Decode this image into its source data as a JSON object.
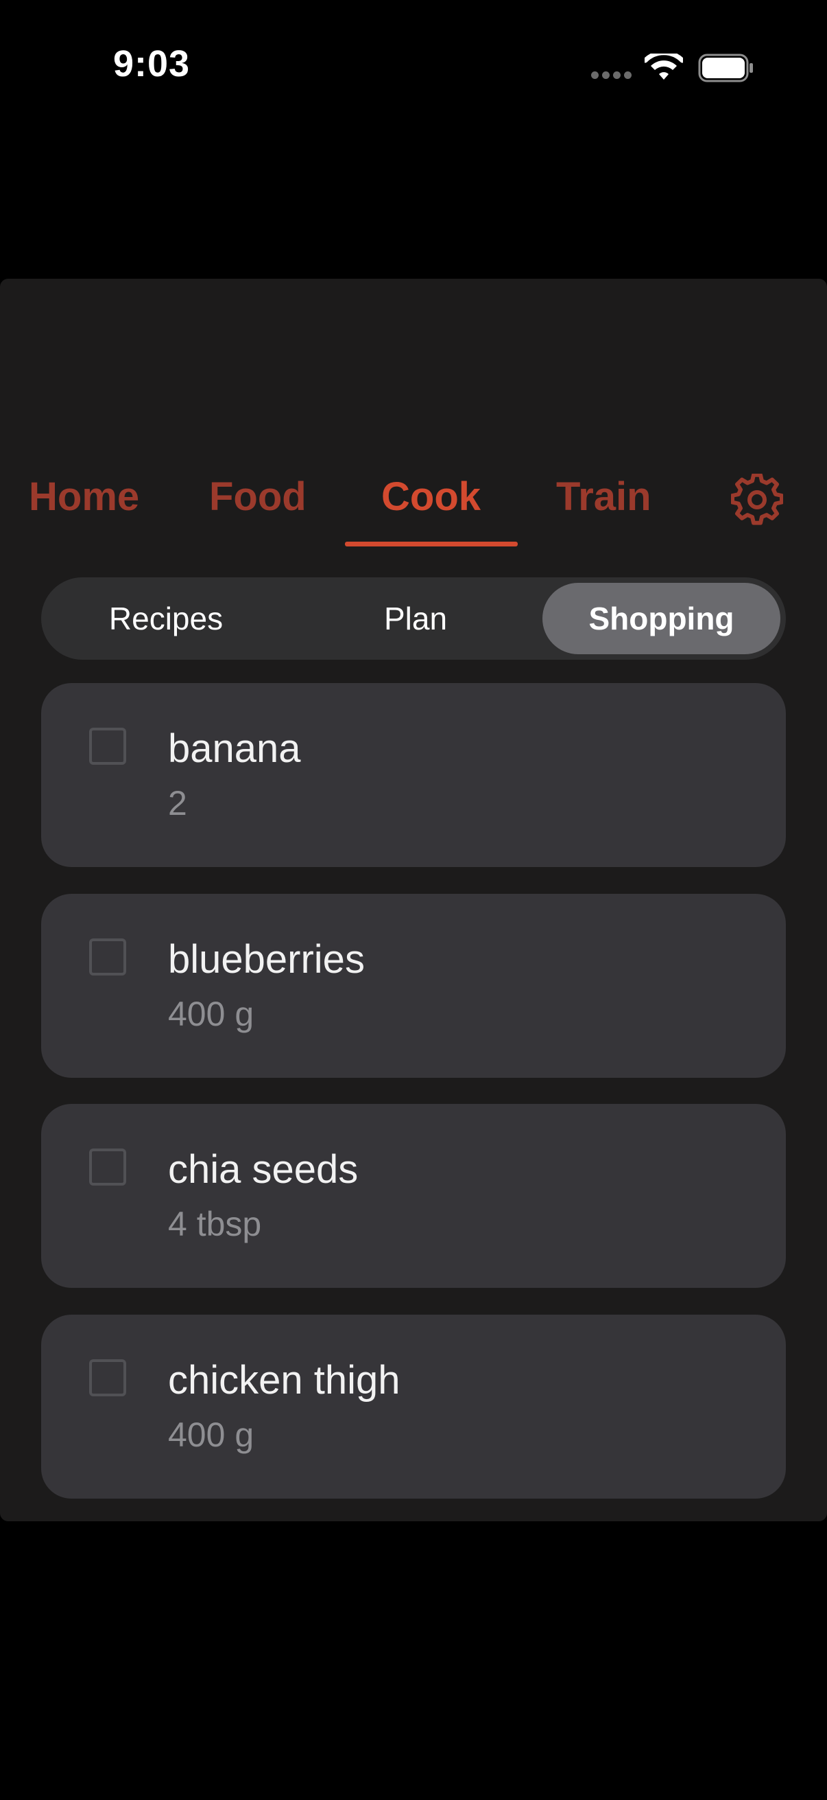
{
  "status_bar": {
    "time": "9:03"
  },
  "top_tabs": [
    {
      "label": "Home",
      "active": false
    },
    {
      "label": "Food",
      "active": false
    },
    {
      "label": "Cook",
      "active": true
    },
    {
      "label": "Train",
      "active": false
    }
  ],
  "settings": {
    "icon": "gear-icon"
  },
  "segments": [
    {
      "label": "Recipes",
      "active": false
    },
    {
      "label": "Plan",
      "active": false
    },
    {
      "label": "Shopping",
      "active": true
    }
  ],
  "shopping_items": [
    {
      "name": "banana",
      "quantity": "2",
      "checked": false
    },
    {
      "name": "blueberries",
      "quantity": "400 g",
      "checked": false
    },
    {
      "name": "chia seeds",
      "quantity": "4 tbsp",
      "checked": false
    },
    {
      "name": "chicken thigh",
      "quantity": "400 g",
      "checked": false
    }
  ],
  "colors": {
    "accent": "#d34a2f",
    "accent_muted": "#9b3a2c",
    "card": "#363539",
    "panel": "#1c1b1b"
  }
}
